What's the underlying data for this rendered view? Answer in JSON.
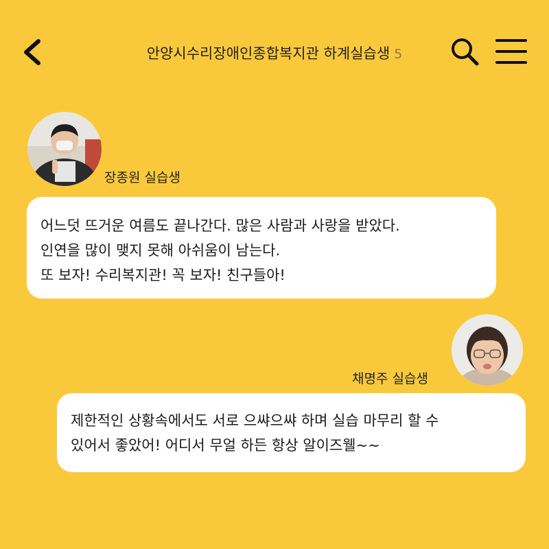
{
  "header": {
    "title": "안양시수리장애인종합복지관 하계실습생",
    "member_count": "5"
  },
  "messages": [
    {
      "sender": "장종원 실습생",
      "lines": [
        "어느덧 뜨거운 여름도 끝나간다. 많은 사람과 사랑을 받았다.",
        "인연을 많이 맺지 못해 아쉬움이 남는다.",
        "또 보자! 수리복지관! 꼭 보자! 친구들아!"
      ]
    },
    {
      "sender": "채명주 실습생",
      "lines": [
        "제한적인 상황속에서도 서로 으쌰으쌰 하며 실습 마무리 할 수",
        "있어서 좋았어! 어디서 무얼 하든 항상 알이즈웰~~"
      ]
    }
  ],
  "icons": {
    "back": "chevron-left-icon",
    "search": "search-icon",
    "menu": "hamburger-menu-icon"
  },
  "colors": {
    "background": "#FAC93B",
    "bubble": "#FFFFFF",
    "text": "#1A1A1A"
  }
}
